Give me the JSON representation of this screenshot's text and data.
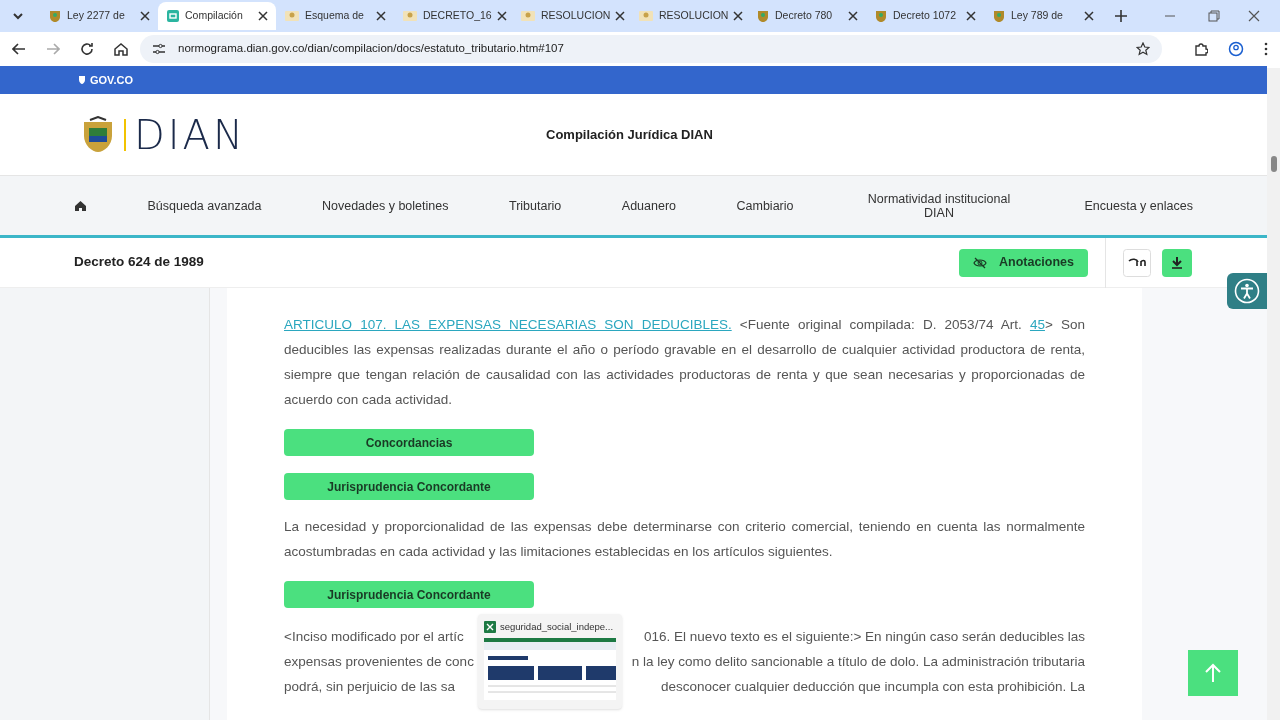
{
  "browser": {
    "tabs": [
      {
        "title": "Ley 2277 de",
        "selected": false
      },
      {
        "title": "Compilación",
        "selected": true
      },
      {
        "title": "Esquema de",
        "selected": false
      },
      {
        "title": "DECRETO_16",
        "selected": false
      },
      {
        "title": "RESOLUCION",
        "selected": false
      },
      {
        "title": "RESOLUCION",
        "selected": false
      },
      {
        "title": "Decreto 780",
        "selected": false
      },
      {
        "title": "Decreto 1072",
        "selected": false
      },
      {
        "title": "Ley 789 de",
        "selected": false
      }
    ],
    "url": "normograma.dian.gov.co/dian/compilacion/docs/estatuto_tributario.htm#107"
  },
  "gov_bar": {
    "label": "GOV.CO"
  },
  "header": {
    "logo_text": "DIAN",
    "title": "Compilación Jurídica DIAN"
  },
  "nav": {
    "items": [
      "Búsqueda avanzada",
      "Novedades y boletines",
      "Tributario",
      "Aduanero",
      "Cambiario",
      "Normatividad institucional DIAN",
      "Encuesta y enlaces"
    ]
  },
  "doc_bar": {
    "title": "Decreto 624 de 1989",
    "annotations_button": "Anotaciones"
  },
  "article": {
    "title_link": "ARTICULO 107. LAS EXPENSAS NECESARIAS SON DEDUCIBLES.",
    "source_text": "<Fuente original compilada: D. 2053/74 Art.",
    "source_link": "45",
    "body": "> Son deducibles las expensas realizadas durante el año o período gravable en el desarrollo de cualquier actividad productora de renta, siempre que tengan relación de causalidad con las actividades productoras de renta y que sean necesarias y proporcionadas de acuerdo con cada actividad."
  },
  "blocks": [
    {
      "kind": "button",
      "label": "Concordancias"
    },
    {
      "kind": "button",
      "label": "Jurisprudencia Concordante"
    },
    {
      "kind": "paragraph",
      "text": "La necesidad y proporcionalidad de las expensas debe determinarse con criterio comercial, teniendo en cuenta las normalmente acostumbradas en cada actividad y las limitaciones establecidas en los artículos siguientes."
    },
    {
      "kind": "button",
      "label": "Jurisprudencia Concordante"
    },
    {
      "kind": "covered_paragraph",
      "lines": [
        {
          "left": "<Inciso modificado por el artíc",
          "right": "016. El nuevo texto es el siguiente:> En ningún caso serán deducibles las"
        },
        {
          "left": "expensas provenientes de conc",
          "right": "n la ley como delito sancionable a título de dolo. La administración tributaria"
        },
        {
          "left": "podrá, sin perjuicio de las sa",
          "right": "desconocer cualquier deducción que incumpla con esta prohibición. La"
        }
      ]
    }
  ],
  "taskbar_preview": {
    "title": "seguridad_social_indepe..."
  }
}
